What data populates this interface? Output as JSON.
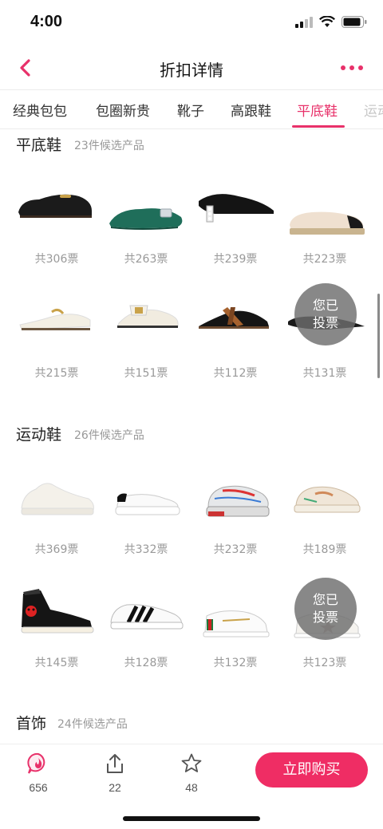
{
  "status": {
    "time": "4:00"
  },
  "nav": {
    "title": "折扣详情"
  },
  "tabs": [
    {
      "label": "经典包包"
    },
    {
      "label": "包圈新贵"
    },
    {
      "label": "靴子"
    },
    {
      "label": "高跟鞋"
    },
    {
      "label": "平底鞋",
      "active": true
    },
    {
      "label": "运动"
    }
  ],
  "sections": [
    {
      "title": "平底鞋",
      "count": "23件候选产品",
      "products": [
        {
          "name": "black-loafer",
          "votes": "共306票"
        },
        {
          "name": "green-satin-flat",
          "votes": "共263票"
        },
        {
          "name": "black-pearl-heel-loafer",
          "votes": "共239票"
        },
        {
          "name": "beige-espadrille",
          "votes": "共223票"
        },
        {
          "name": "white-horsebit-slipper",
          "votes": "共215票"
        },
        {
          "name": "white-bow-loafer",
          "votes": "共151票"
        },
        {
          "name": "black-tan-slipper",
          "votes": "共112票"
        },
        {
          "name": "black-pointed-flat",
          "votes": "共131票",
          "voted": "您已\n投票"
        }
      ]
    },
    {
      "title": "运动鞋",
      "count": "26件候选产品",
      "products": [
        {
          "name": "white-knit-sneaker",
          "votes": "共369票"
        },
        {
          "name": "white-platform-sneaker",
          "votes": "共332票"
        },
        {
          "name": "chunky-dad-sneaker",
          "votes": "共232票"
        },
        {
          "name": "cream-retro-sneaker",
          "votes": "共189票"
        },
        {
          "name": "black-high-top",
          "votes": "共145票"
        },
        {
          "name": "white-black-stripe-sneaker",
          "votes": "共128票"
        },
        {
          "name": "white-webbing-sneaker",
          "votes": "共132票"
        },
        {
          "name": "white-star-sneaker",
          "votes": "共123票",
          "voted": "您已\n投票"
        }
      ]
    },
    {
      "title": "首饰",
      "count": "24件候选产品"
    }
  ],
  "bottom": {
    "likes": "656",
    "shares": "22",
    "favorites": "48",
    "buy_label": "立即购买"
  },
  "colors": {
    "accent": "#e8316a",
    "buy": "#ef2d64"
  }
}
